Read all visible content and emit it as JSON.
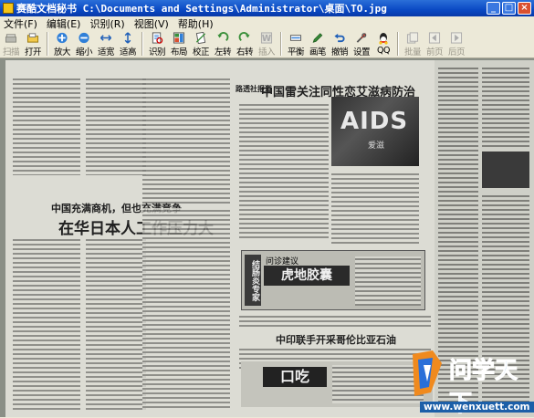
{
  "window": {
    "title": "赛酷文档秘书 C:\\Documents and Settings\\Administrator\\桌面\\TO.jpg",
    "minimize_glyph": "_",
    "maximize_glyph": "□",
    "close_glyph": "×"
  },
  "menu": {
    "items": [
      {
        "label": "文件(F)"
      },
      {
        "label": "编辑(E)"
      },
      {
        "label": "识别(R)"
      },
      {
        "label": "视图(V)"
      },
      {
        "label": "帮助(H)"
      }
    ]
  },
  "toolbar": {
    "buttons": [
      {
        "label": "扫描",
        "icon": "scanner-icon",
        "enabled": false
      },
      {
        "label": "打开",
        "icon": "open-folder-icon",
        "enabled": true
      },
      {
        "label": "放大",
        "icon": "zoom-in-icon",
        "enabled": true
      },
      {
        "label": "缩小",
        "icon": "zoom-out-icon",
        "enabled": true
      },
      {
        "label": "适宽",
        "icon": "fit-width-icon",
        "enabled": true
      },
      {
        "label": "适高",
        "icon": "fit-height-icon",
        "enabled": true
      },
      {
        "label": "识别",
        "icon": "recognize-icon",
        "enabled": true
      },
      {
        "label": "布局",
        "icon": "layout-icon",
        "enabled": true
      },
      {
        "label": "校正",
        "icon": "deskew-icon",
        "enabled": true
      },
      {
        "label": "左转",
        "icon": "rotate-left-icon",
        "enabled": true
      },
      {
        "label": "右转",
        "icon": "rotate-right-icon",
        "enabled": true
      },
      {
        "label": "插入",
        "icon": "insert-icon",
        "enabled": false
      },
      {
        "label": "平衡",
        "icon": "balance-icon",
        "enabled": true
      },
      {
        "label": "画笔",
        "icon": "pen-icon",
        "enabled": true
      },
      {
        "label": "撤销",
        "icon": "undo-icon",
        "enabled": true
      },
      {
        "label": "设置",
        "icon": "settings-icon",
        "enabled": true
      },
      {
        "label": "QQ",
        "icon": "qq-icon",
        "enabled": true
      },
      {
        "label": "批量",
        "icon": "batch-icon",
        "enabled": false
      },
      {
        "label": "前页",
        "icon": "prev-page-icon",
        "enabled": false
      },
      {
        "label": "后页",
        "icon": "next-page-icon",
        "enabled": false
      }
    ]
  },
  "document": {
    "headline_left_1": "中国充满商机，但也充满竞争",
    "headline_left_2": "在华日本人工作压力大",
    "headline_right_kicker": "路透社报道",
    "headline_right": "中国雷关注同性恋艾滋病防治",
    "aids_graphic_text": "AIDS",
    "aids_graphic_caption": "爱滋",
    "ad_brand_1": "结肠炎专家",
    "ad_brand_2": "虎地胶囊",
    "ad_side": "问诊建议",
    "headline_bottom": "中印联手开采哥伦比亚石油",
    "ad_bottom_text": "口吃"
  },
  "watermark": {
    "text": "问学天下",
    "url": "www.wenxuett.com"
  },
  "colors": {
    "titlebar": "#0a49c4",
    "watermark_blue": "#1d83d6",
    "watermark_orange": "#f08a1e"
  }
}
